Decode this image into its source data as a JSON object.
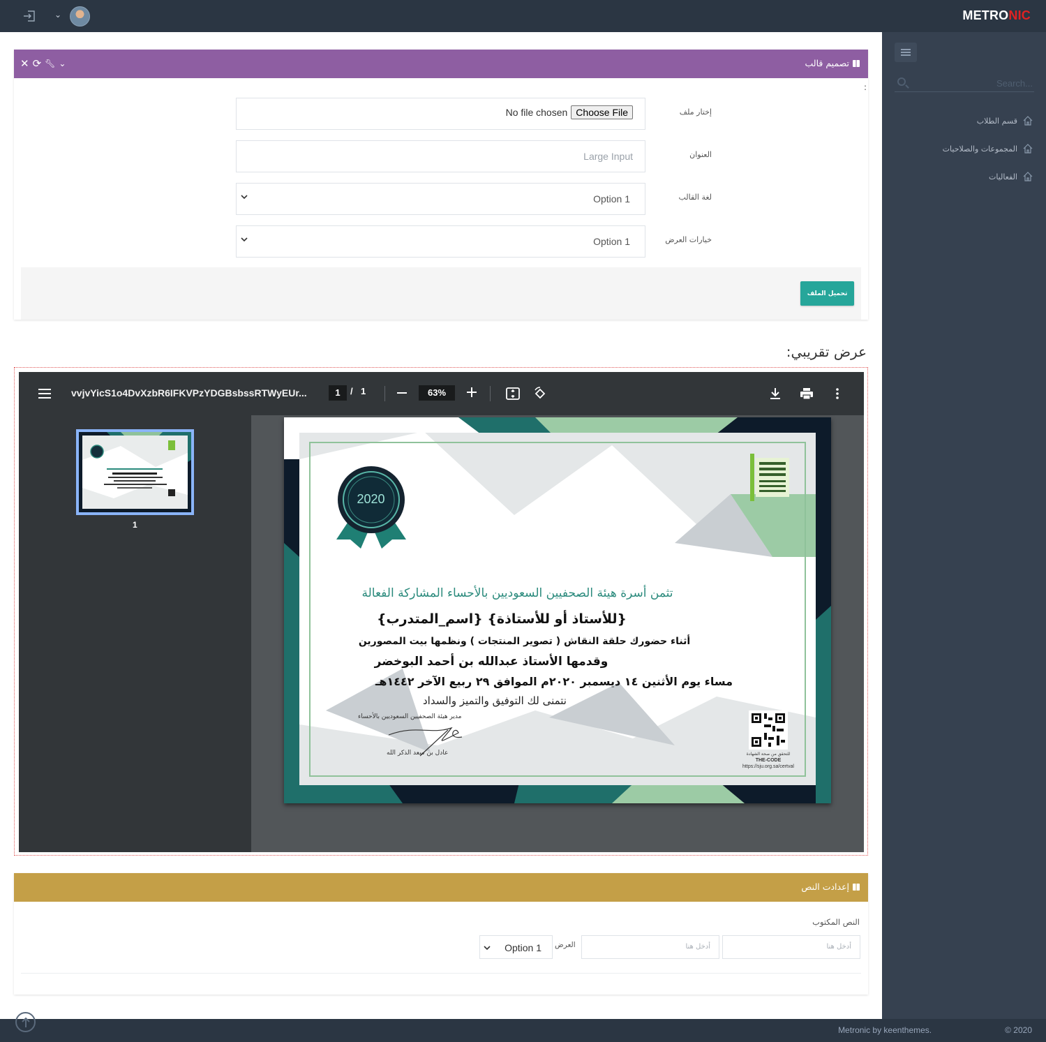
{
  "header": {
    "logo_main": "METRO",
    "logo_accent": "NIC",
    "user_caret": "⌄"
  },
  "sidebar": {
    "search_placeholder": "Search...",
    "items": [
      {
        "label": "قسم الطلاب",
        "icon": "home-icon"
      },
      {
        "label": "المجموعات والصلاحيات",
        "icon": "home-icon"
      },
      {
        "label": "الفعاليات",
        "icon": "home-icon"
      }
    ]
  },
  "template_design": {
    "title": "تصميم قالب",
    "colon": ":",
    "file_label": "إختار ملف",
    "file_button": "Choose File",
    "file_status": "No file chosen",
    "title_label": "العنوان",
    "title_placeholder": "Large Input",
    "language_label": "لغة القالب",
    "language_value": "Option 1",
    "display_label": "خيارات العرض",
    "display_value": "Option 1",
    "upload_button": "تحميل الملف"
  },
  "preview": {
    "heading": "عرض تقريبي:",
    "pdf": {
      "file_name": "vvjvYicS1o4DvXzbR6IFKVPzYDGBsbssRTWyEUr...",
      "current_page": "1",
      "page_separator": "/",
      "total_pages": "1",
      "zoom": "63%",
      "thumbnail_number": "1"
    },
    "certificate": {
      "seal_year": "2020",
      "line1": "تثمن أسرة هيئة الصحفيين السعوديين بالأحساء المشاركة الفعالة",
      "line2": "{للأستاذ أو للأستاذة} {اسم_المتدرب}",
      "line3": "أثناء حضورك حلقة النقاش ( تصوير المنتجات ) ونظمها بيت المصورين",
      "line4": "وقدمها الأستاذ عبدالله بن أحمد البوخضر",
      "line5": "مساء يوم الأثنين ١٤ ديسمبر ٢٠٢٠م الموافق ٢٩ ربيع الآخر ١٤٤٢هـ",
      "line6": "نتمنى لك التوفيق والتميز والسداد",
      "signer_title": "مدير هيئة الصحفيين السعوديين بالأحساء",
      "signer_name": "عادل بن سعد الذكر الله",
      "qr_caption": "للتحقق من صحة الشهادة",
      "qr_code_label": "THE-CODE",
      "qr_url": "https://sju.org.sa/certval"
    }
  },
  "text_settings": {
    "title": "إعدادت النص",
    "written_text_label": "النص المكتوب",
    "input1_placeholder": "أدخل هنا",
    "input2_placeholder": "أدخل هنا",
    "width_label": "العرض",
    "width_value": "Option 1"
  },
  "footer": {
    "text": "Metronic by keenthemes.",
    "year": "© 2020"
  },
  "colors": {
    "header_bg": "#2b3643",
    "sidebar_bg": "#364150",
    "portlet_purple": "#8e5ea2",
    "portlet_gold": "#c49f47",
    "upload_button": "#26a69a",
    "logo_accent": "#e02222"
  }
}
